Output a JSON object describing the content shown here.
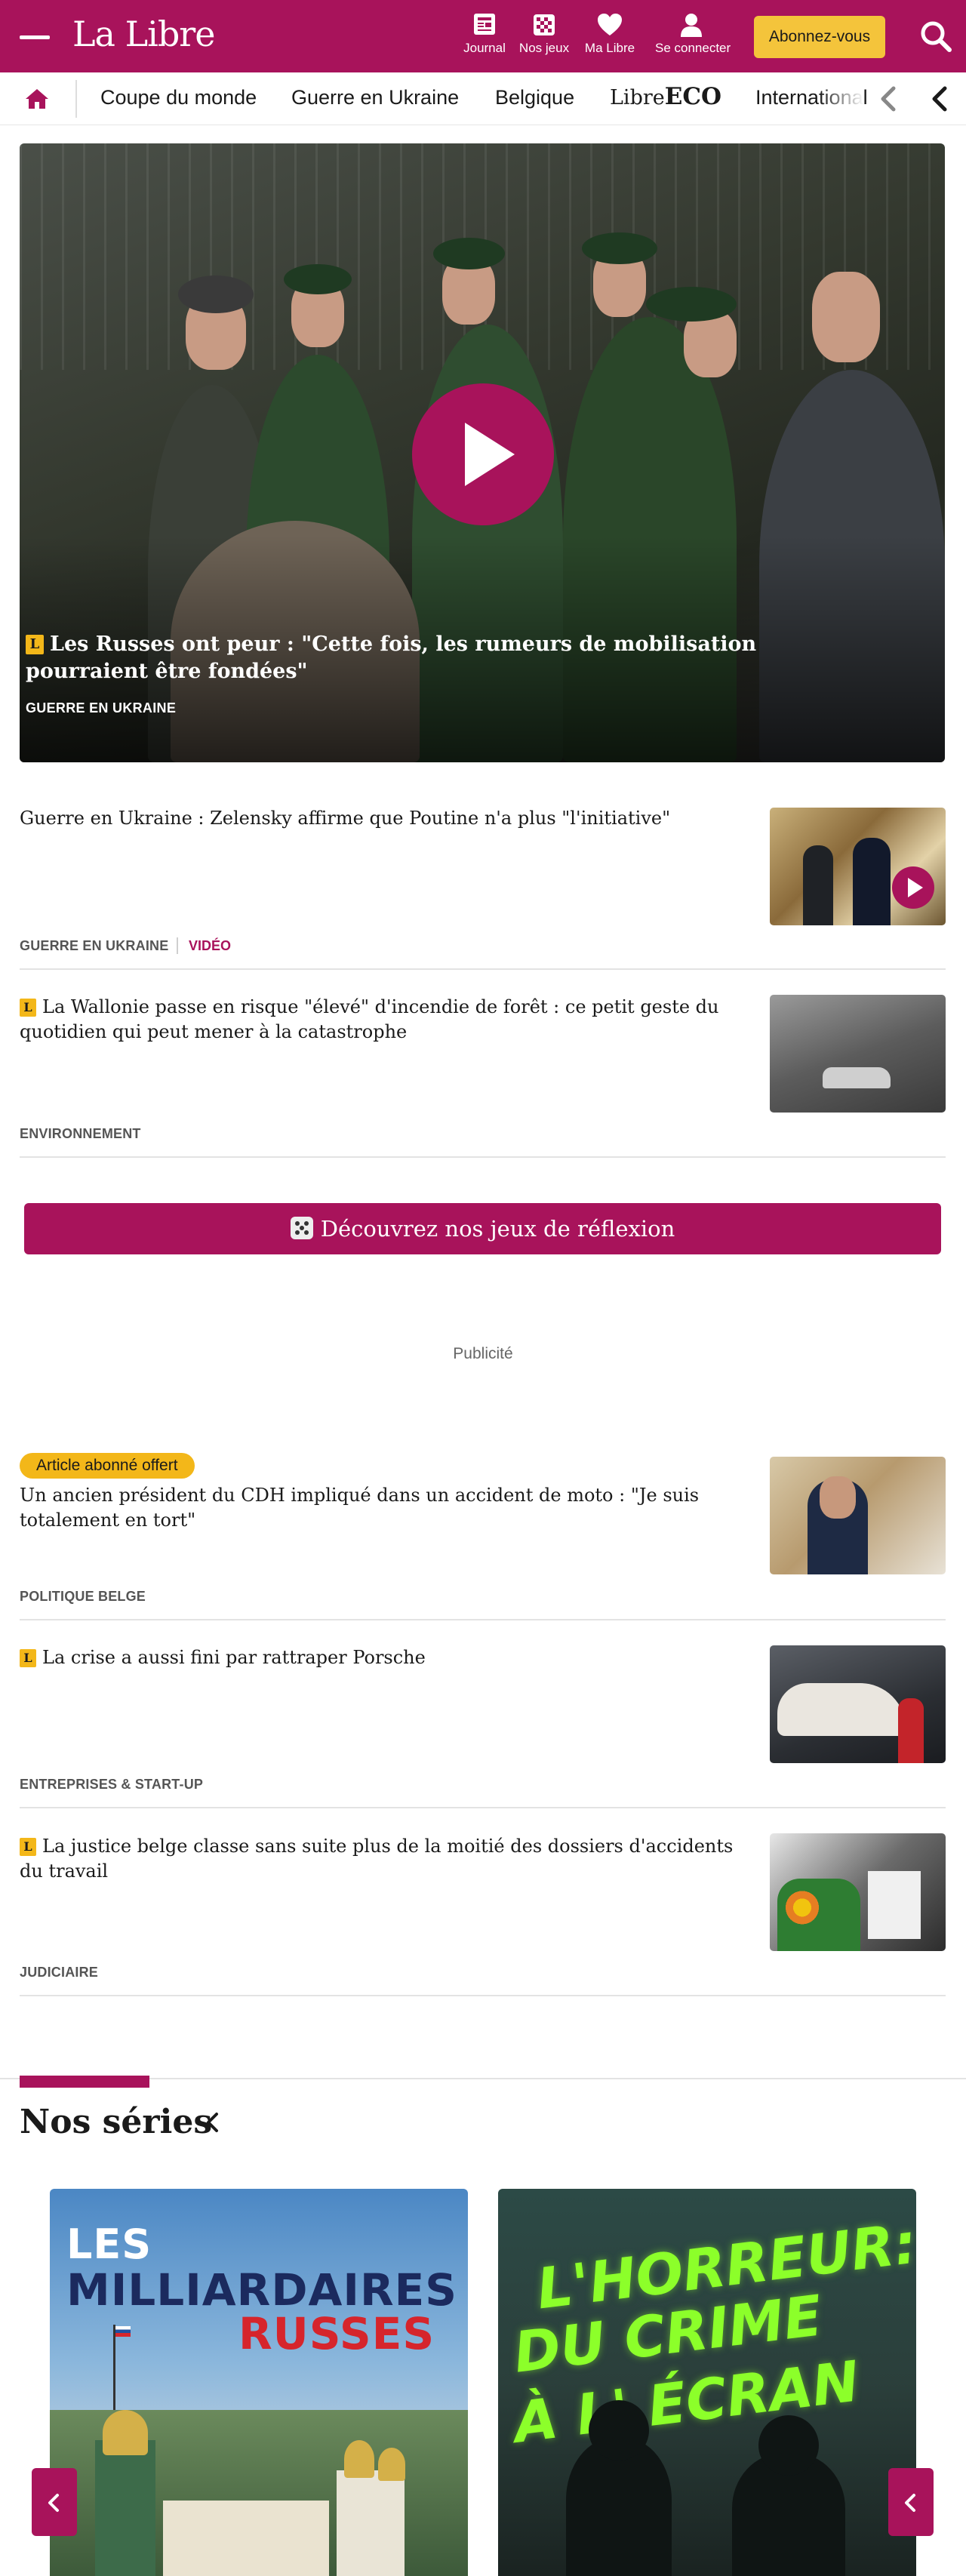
{
  "header": {
    "logo": "La Libre",
    "journal_label": "Journal",
    "games_label": "Nos jeux",
    "my_libre_label": "Ma Libre",
    "login_label": "Se connecter",
    "subscribe_label": "Abonnez-vous"
  },
  "nav": {
    "items": [
      "Coupe du monde",
      "Guerre en Ukraine",
      "Belgique",
      "International"
    ],
    "eco_logo_prefix": "Libre",
    "eco_logo_suffix": "ECO"
  },
  "hero": {
    "badge": "L",
    "title": "Les Russes ont peur : \"Cette fois, les rumeurs de mobilisation pourraient être fondées\"",
    "category": "GUERRE EN UKRAINE"
  },
  "articles": [
    {
      "title": "Guerre en Ukraine : Zelensky affirme que Poutine n'a plus \"l'initiative\"",
      "category": "GUERRE EN UKRAINE",
      "tag": "VIDÉO"
    },
    {
      "badge": "L",
      "title": "La Wallonie passe en risque \"élevé\" d'incendie de forêt : ce petit geste du quotidien qui peut mener à la catastrophe",
      "category": "ENVIRONNEMENT"
    },
    {
      "offer": "Article abonné offert",
      "title": "Un ancien président du CDH impliqué dans un accident de moto : \"Je suis totalement en tort\"",
      "category": "POLITIQUE BELGE"
    },
    {
      "badge": "L",
      "title": "La crise a aussi fini par rattraper Porsche",
      "category": "ENTREPRISES & START-UP"
    },
    {
      "badge": "L",
      "title": "La justice belge classe sans suite plus de la moitié des dossiers d'accidents du travail",
      "category": "JUDICIAIRE"
    }
  ],
  "games_button": "Découvrez nos jeux de réflexion",
  "ad_label": "Publicité",
  "series": {
    "title": "Nos séries",
    "cards": [
      {
        "lines": [
          "LES",
          "MILLIARDAIRES",
          "RUSSES"
        ]
      },
      {
        "lines": [
          "L'HORREUR:",
          "DU CRIME",
          "À L' ÉCRAN"
        ]
      }
    ]
  },
  "colors": {
    "brand": "#a8135b",
    "accent_yellow": "#f3b719",
    "subscribe_bg": "#f4c43b"
  }
}
